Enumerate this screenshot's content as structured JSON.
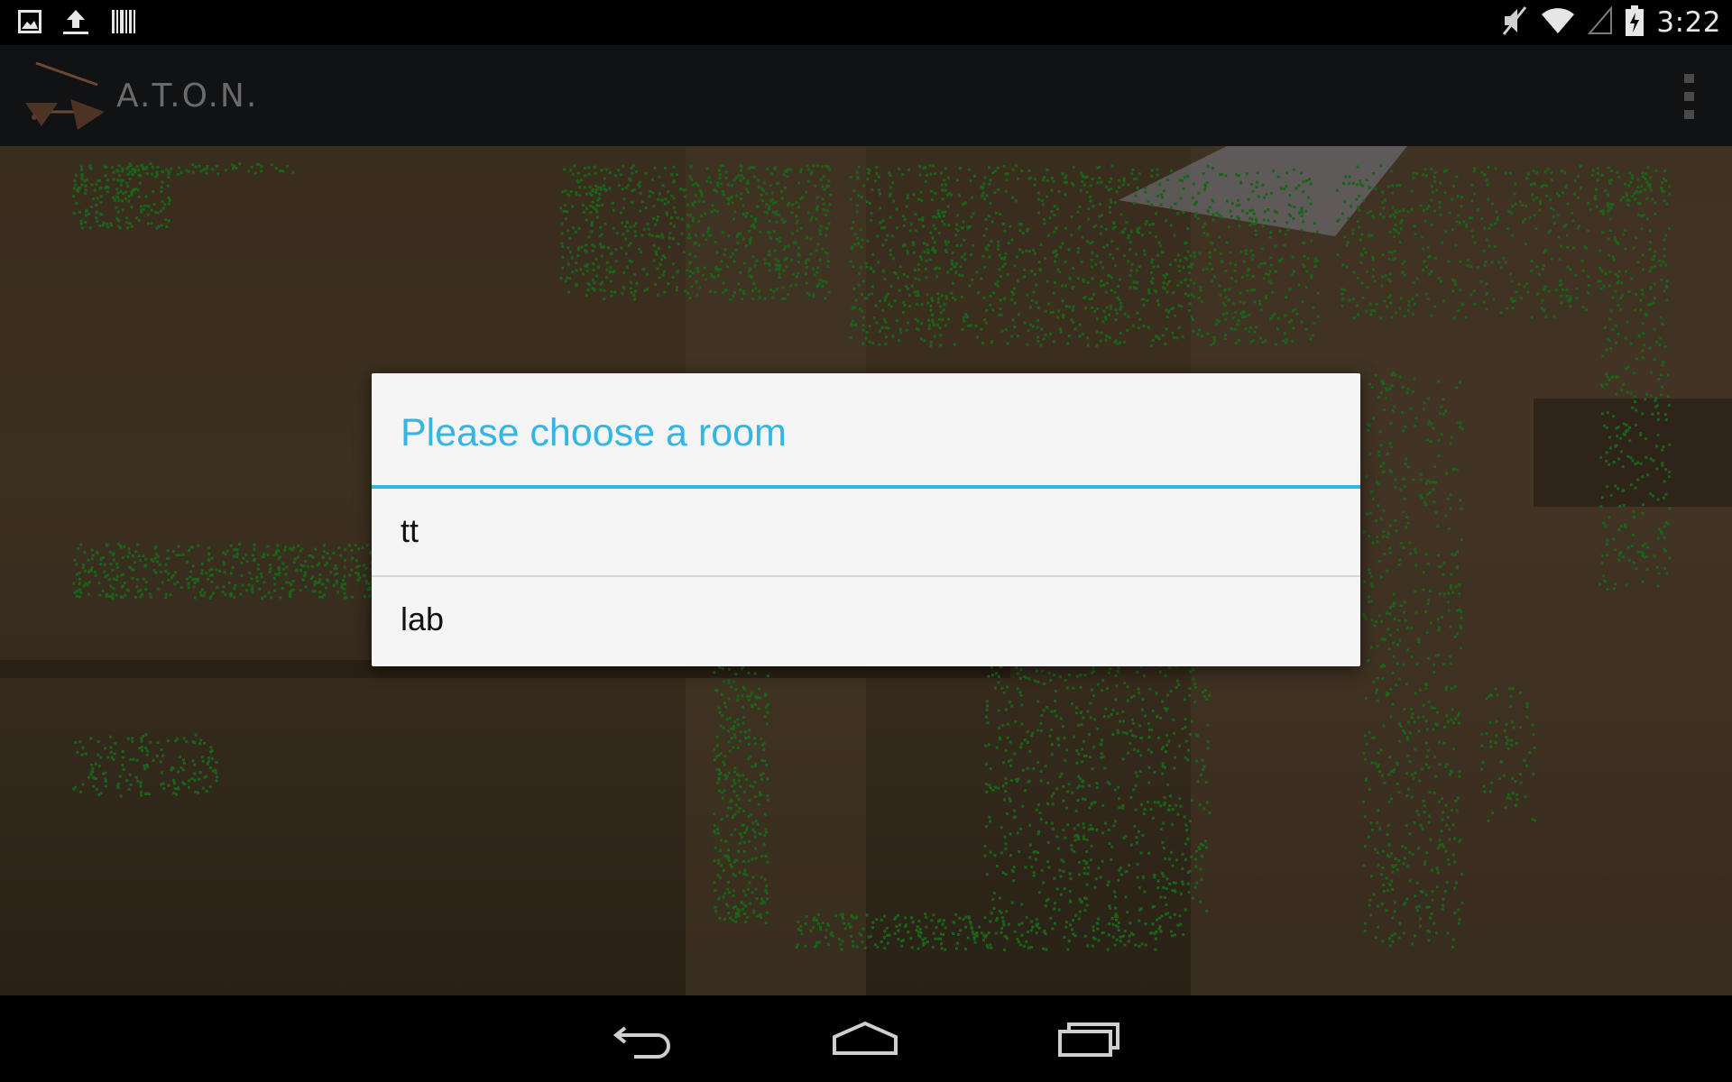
{
  "status_bar": {
    "clock": "3:22",
    "left_icons": [
      "image-icon",
      "upload-icon",
      "barcode-icon"
    ],
    "right_icons": [
      "mute-icon",
      "wifi-icon",
      "signal-icon",
      "battery-charging-icon"
    ]
  },
  "action_bar": {
    "title": "A.T.O.N.",
    "overflow_icon": "overflow-menu-icon"
  },
  "dialog": {
    "title": "Please choose a room",
    "items": [
      {
        "label": "tt"
      },
      {
        "label": "lab"
      }
    ]
  },
  "nav_bar": {
    "buttons": [
      "back-icon",
      "home-icon",
      "recent-apps-icon"
    ]
  },
  "colors": {
    "accent": "#33b5e5",
    "feature_points": "#1f7a1f",
    "camera_tint": "#463725",
    "action_bar": "#111214"
  }
}
